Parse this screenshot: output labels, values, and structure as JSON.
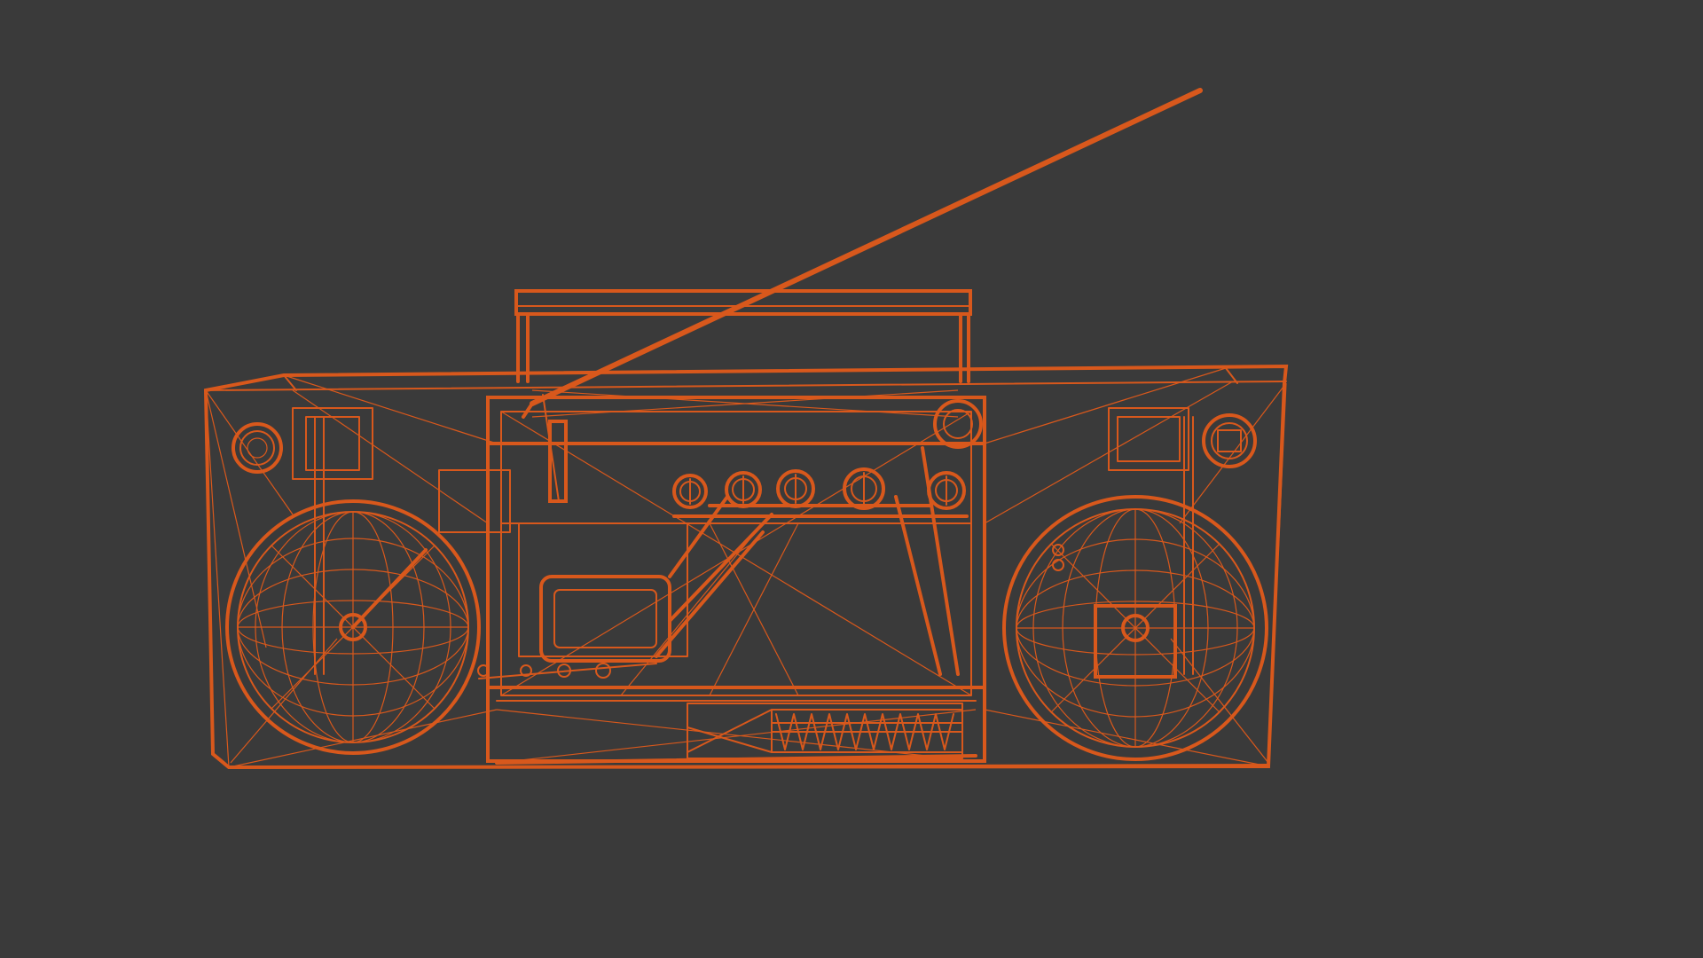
{
  "viewport": {
    "background_color": "#3a3a3a",
    "wireframe_color": "#d8581c",
    "render_mode": "wireframe",
    "object": "boombox-model",
    "parts": {
      "handle": "handle",
      "antenna": "antenna",
      "body": "body",
      "left_speaker": "left-speaker",
      "right_speaker": "right-speaker",
      "left_tweeter": "left-tweeter",
      "right_tweeter": "right-tweeter",
      "control_knobs": [
        "knob-1",
        "knob-2",
        "knob-3",
        "knob-4",
        "knob-5"
      ],
      "cassette_deck": "cassette-deck",
      "grille": "bottom-grille"
    }
  }
}
